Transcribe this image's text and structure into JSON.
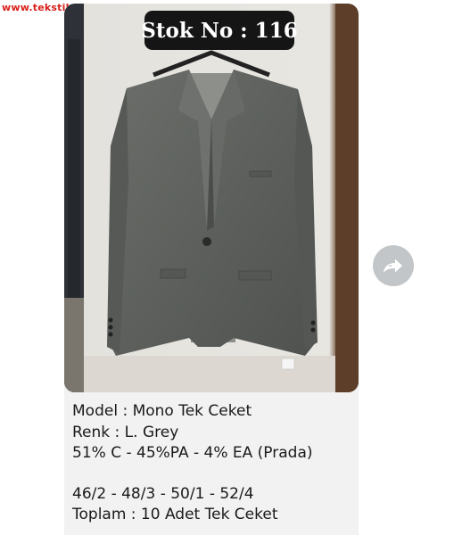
{
  "watermark": "www.tekstilportal.com",
  "post": {
    "stock_label": "Stok No : 116",
    "caption_lines": [
      "Model : Mono Tek Ceket",
      "Renk : L. Grey",
      "51% C - 45%PA - 4% EA (Prada)",
      "",
      "46/2 - 48/3 - 50/1 - 52/4",
      "Toplam : 10 Adet Tek Ceket"
    ]
  },
  "icons": {
    "share": "forward-share-icon"
  },
  "colors": {
    "jacket": "#5f625e",
    "badge_bg": "#151515",
    "share_bg": "#c3c6c8",
    "watermark": "#d8201a"
  }
}
